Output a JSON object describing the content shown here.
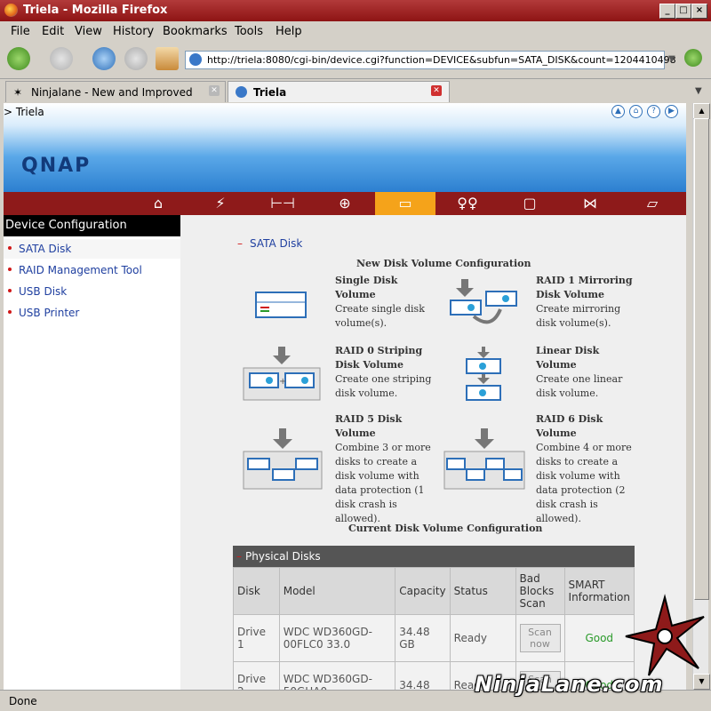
{
  "window": {
    "title": "Triela - Mozilla Firefox"
  },
  "menu": [
    "File",
    "Edit",
    "View",
    "History",
    "Bookmarks",
    "Tools",
    "Help"
  ],
  "url": "http://triela:8080/cgi-bin/device.cgi?function=DEVICE&subfun=SATA_DISK&count=1204410498",
  "tabs": [
    {
      "label": "Ninjalane - New and Improved"
    },
    {
      "label": "Triela"
    }
  ],
  "page": {
    "breadcrumb": "> Triela",
    "logo": "QNAP",
    "sidebar": {
      "header": "Device Configuration",
      "items": [
        "SATA Disk",
        "RAID Management Tool",
        "USB Disk",
        "USB Printer"
      ]
    },
    "main": {
      "section_label": "SATA Disk",
      "new_config_title": "New Disk Volume Configuration",
      "options": [
        {
          "title": "Single Disk Volume",
          "desc": "Create single disk volume(s)."
        },
        {
          "title": "RAID 1 Mirroring Disk Volume",
          "desc": "Create mirroring disk volume(s)."
        },
        {
          "title": "RAID 0 Striping Disk Volume",
          "desc": "Create one striping disk volume."
        },
        {
          "title": "Linear Disk Volume",
          "desc": "Create one linear disk volume."
        },
        {
          "title": "RAID 5 Disk Volume",
          "desc": "Combine 3 or more disks to create a disk volume with data protection (1 disk crash is allowed)."
        },
        {
          "title": "RAID 6 Disk Volume",
          "desc": "Combine 4 or more disks to create a disk volume with data protection (2 disk crash is allowed)."
        }
      ],
      "current_config_title": "Current Disk Volume Configuration",
      "physical_disks": {
        "header": "Physical Disks",
        "columns": [
          "Disk",
          "Model",
          "Capacity",
          "Status",
          "Bad Blocks Scan",
          "SMART Information"
        ],
        "rows": [
          {
            "disk": "Drive 1",
            "model": "WDC WD360GD-00FLC0 33.0",
            "capacity": "34.48 GB",
            "status": "Ready",
            "scan": "Scan now",
            "smart": "Good"
          },
          {
            "disk": "Drive 2",
            "model": "WDC WD360GD-50GHA0",
            "capacity": "34.48",
            "status": "Ready",
            "scan": "Scan now",
            "smart": "Good"
          }
        ]
      }
    }
  },
  "status": "Done",
  "watermark": "NinjaLane.com",
  "colors": {
    "accent": "#8e1a1a",
    "active_nav": "#f5a31a",
    "link": "#2040a0",
    "good": "#2a9a2a"
  }
}
